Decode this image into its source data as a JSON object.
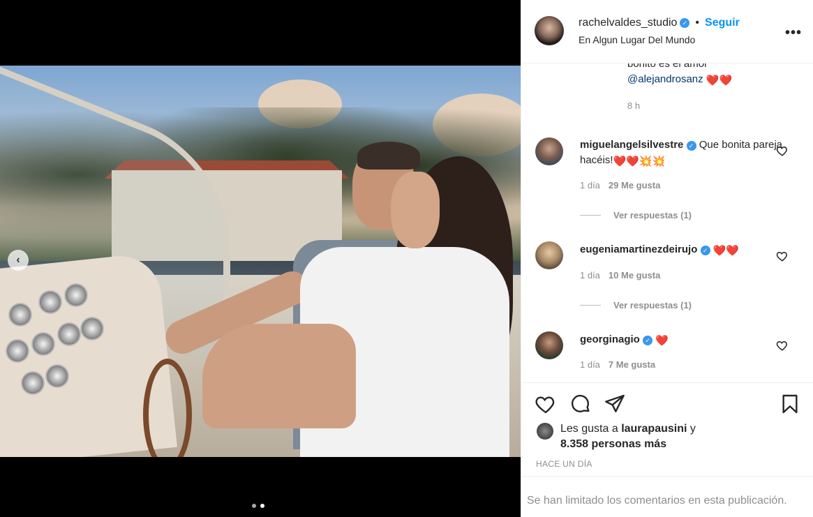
{
  "post": {
    "username": "rachelvaldes_studio",
    "follow_label": "Seguir",
    "bullet": "•",
    "location": "En Algun Lugar Del Mundo",
    "more_label": "•••",
    "carousel": {
      "total_slides": 2,
      "active_slide": 2
    }
  },
  "caption": {
    "tail_text": "bonito es el amor",
    "mention": "@alejandrosanz",
    "emojis": "❤️❤️",
    "time": "8 h"
  },
  "comments": [
    {
      "username": "miguelangelsilvestre",
      "text": "Que bonita pareja hacéis!",
      "emojis": "❤️❤️💥💥",
      "time": "1 día",
      "likes": "29 Me gusta",
      "replies": "Ver respuestas (1)"
    },
    {
      "username": "eugeniamartinezdeirujo",
      "text": "",
      "emojis": "❤️❤️",
      "time": "1 día",
      "likes": "10 Me gusta",
      "replies": "Ver respuestas (1)"
    },
    {
      "username": "georginagio",
      "text": "",
      "emojis": "❤️",
      "time": "1 día",
      "likes": "7 Me gusta"
    }
  ],
  "likes": {
    "prefix": "Les gusta a",
    "user": "laurapausini",
    "suffix": "y",
    "others": "8.358 personas más"
  },
  "timestamp": "HACE UN DÍA",
  "comments_limited": "Se han limitado los comentarios en esta publicación.",
  "colors": {
    "link_blue": "#0095f6",
    "verified_blue": "#3897f0",
    "mention": "#00376b",
    "muted": "#8e8e8e",
    "heart_red": "#ed1c24"
  },
  "icons": [
    "heart-icon",
    "comment-icon",
    "share-icon",
    "bookmark-icon",
    "more-icon",
    "verified-icon",
    "chevron-left-icon"
  ]
}
